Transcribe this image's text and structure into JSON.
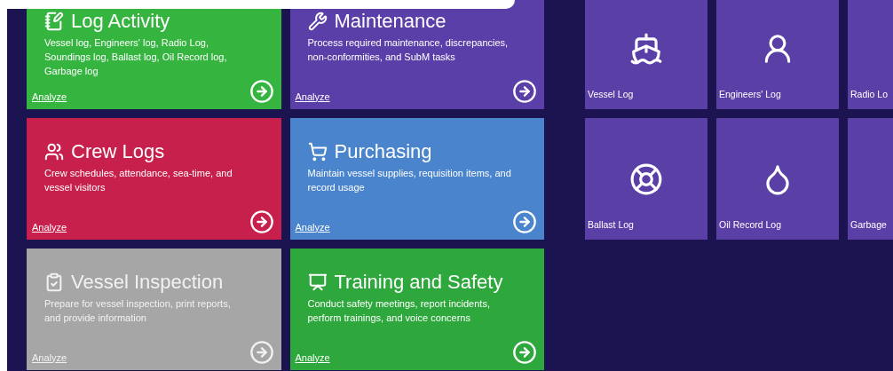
{
  "activity_tiles": [
    {
      "title": "Log Activity",
      "description": "Vessel log, Engineers' log, Radio Log, Soundings log, Ballast log, Oil Record log, Garbage log",
      "link": "Analyze",
      "color": "#36b440",
      "disabled": false
    },
    {
      "title": "Maintenance",
      "description": "Process required maintenance, discrepancies, non-conformities, and SubM tasks",
      "link": "Analyze",
      "color": "#5b3fa8",
      "disabled": false
    },
    {
      "title": "Crew Logs",
      "description": "Crew schedules, attendance, sea-time, and vessel visitors",
      "link": "Analyze",
      "color": "#c8204c",
      "disabled": false
    },
    {
      "title": "Purchasing",
      "description": "Maintain vessel supplies, requisition items, and record usage",
      "link": "Analyze",
      "color": "#4a84cc",
      "disabled": false
    },
    {
      "title": "Vessel Inspection",
      "description": "Prepare for vessel inspection, print reports, and provide information",
      "link": "Analyze",
      "color": "#a6a6a6",
      "disabled": true
    },
    {
      "title": "Training and Safety",
      "description": "Conduct safety meetings, report incidents, perform trainings, and voice concerns",
      "link": "Analyze",
      "color": "#2ea83c",
      "disabled": false
    }
  ],
  "log_tiles": [
    {
      "label": "Vessel Log"
    },
    {
      "label": "Engineers' Log"
    },
    {
      "label": "Radio Lo"
    },
    {
      "label": "Ballast Log"
    },
    {
      "label": "Oil Record Log"
    },
    {
      "label": "Garbage"
    }
  ]
}
